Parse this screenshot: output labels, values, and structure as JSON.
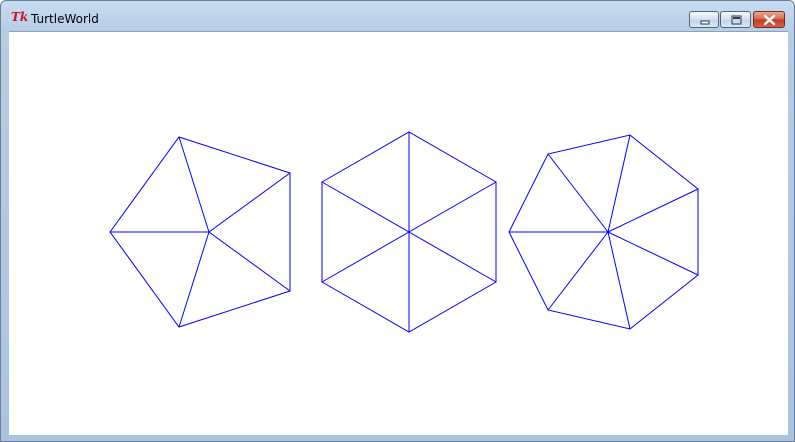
{
  "window": {
    "title": "TurtleWorld",
    "icon": "tk-feather-icon",
    "icon_text": "Tk",
    "controls": [
      "minimize-icon",
      "maximize-icon",
      "close-icon"
    ]
  },
  "canvas": {
    "background": "#ffffff",
    "stroke_color": "#0000ff",
    "shapes": [
      {
        "name": "pentagon",
        "sides": 5
      },
      {
        "name": "hexagon",
        "sides": 6
      },
      {
        "name": "heptagon",
        "sides": 7
      }
    ]
  }
}
